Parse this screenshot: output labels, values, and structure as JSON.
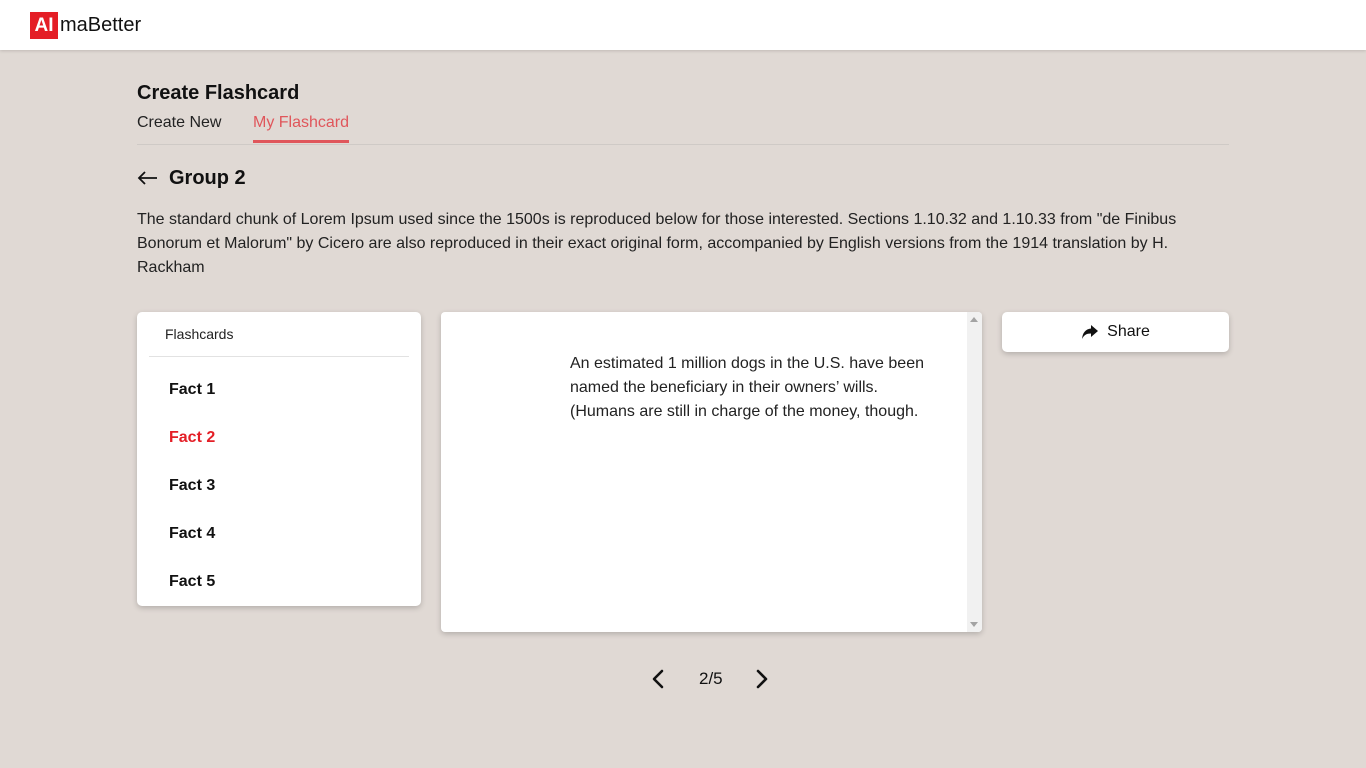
{
  "brand": {
    "badge": "AI",
    "name": "maBetter",
    "accent": "#e41e26"
  },
  "page": {
    "title": "Create Flashcard"
  },
  "tabs": [
    {
      "label": "Create New",
      "active": false
    },
    {
      "label": "My Flashcard",
      "active": true
    }
  ],
  "group": {
    "title": "Group 2",
    "description": "The standard chunk of Lorem Ipsum used since the 1500s is reproduced below for those interested. Sections 1.10.32 and 1.10.33 from \"de Finibus Bonorum et Malorum\" by Cicero are also reproduced in their exact original form, accompanied by English versions from the 1914 translation by H. Rackham"
  },
  "sidebar": {
    "header": "Flashcards",
    "items": [
      {
        "label": "Fact 1",
        "active": false
      },
      {
        "label": "Fact 2",
        "active": true
      },
      {
        "label": "Fact 3",
        "active": false
      },
      {
        "label": "Fact 4",
        "active": false
      },
      {
        "label": "Fact 5",
        "active": false
      }
    ]
  },
  "card": {
    "text": "An estimated 1 million dogs in the U.S. have been named the beneficiary in their owners’ wills. (Humans are still in charge of the money, though."
  },
  "share": {
    "label": "Share",
    "icon": "share-icon"
  },
  "pager": {
    "text": "2/5",
    "prev_icon": "chevron-left-icon",
    "next_icon": "chevron-right-icon"
  }
}
